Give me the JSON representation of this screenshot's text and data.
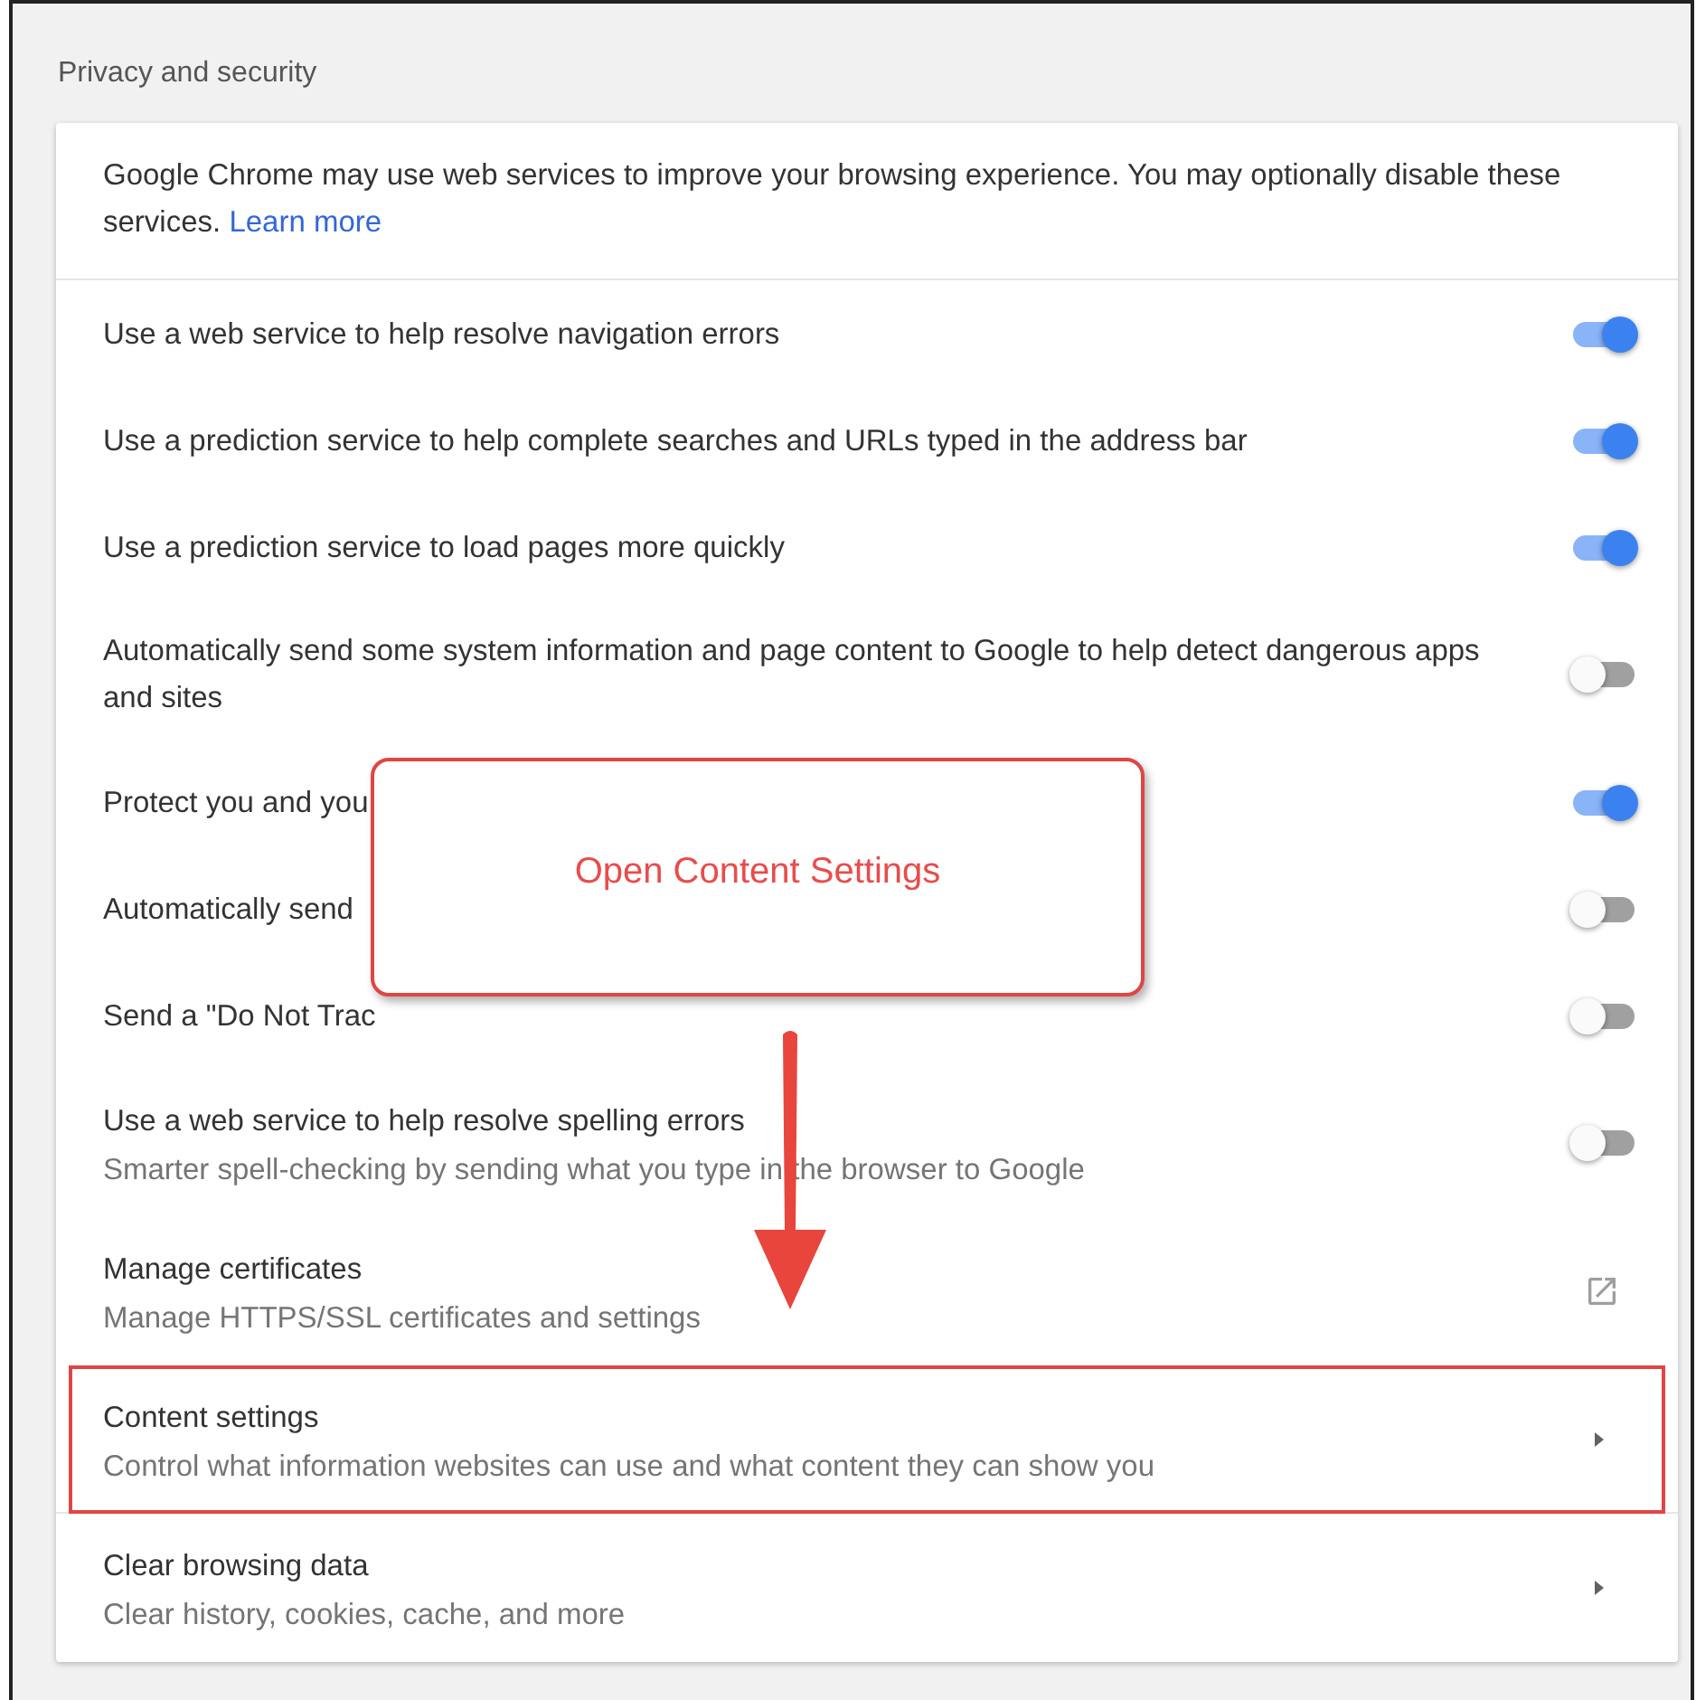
{
  "section_title": "Privacy and security",
  "intro": {
    "text": "Google Chrome may use web services to improve your browsing experience. You may optionally disable these services.",
    "link": "Learn more"
  },
  "rows": [
    {
      "kind": "toggle",
      "label": "Use a web service to help resolve navigation errors",
      "on": true
    },
    {
      "kind": "toggle",
      "label": "Use a prediction service to help complete searches and URLs typed in the address bar",
      "on": true
    },
    {
      "kind": "toggle",
      "label": "Use a prediction service to load pages more quickly",
      "on": true
    },
    {
      "kind": "toggle",
      "label": "Automatically send some system information and page content to Google to help detect dangerous apps and sites",
      "on": false
    },
    {
      "kind": "toggle",
      "label": "Protect you and you",
      "on": true
    },
    {
      "kind": "toggle",
      "label": "Automatically send",
      "on": false
    },
    {
      "kind": "toggle",
      "label": "Send a \"Do Not Trac",
      "on": false
    },
    {
      "kind": "toggle",
      "label": "Use a web service to help resolve spelling errors",
      "sublabel": "Smarter spell-checking by sending what you type in the browser to Google",
      "on": false
    },
    {
      "kind": "external",
      "label": "Manage certificates",
      "sublabel": "Manage HTTPS/SSL certificates and settings"
    },
    {
      "kind": "submenu",
      "label": "Content settings",
      "sublabel": "Control what information websites can use and what content they can show you",
      "highlighted": true
    },
    {
      "kind": "submenu",
      "label": "Clear browsing data",
      "sublabel": "Clear history, cookies, cache, and more",
      "highlighted": false
    }
  ],
  "callout": {
    "text": "Open Content Settings"
  }
}
